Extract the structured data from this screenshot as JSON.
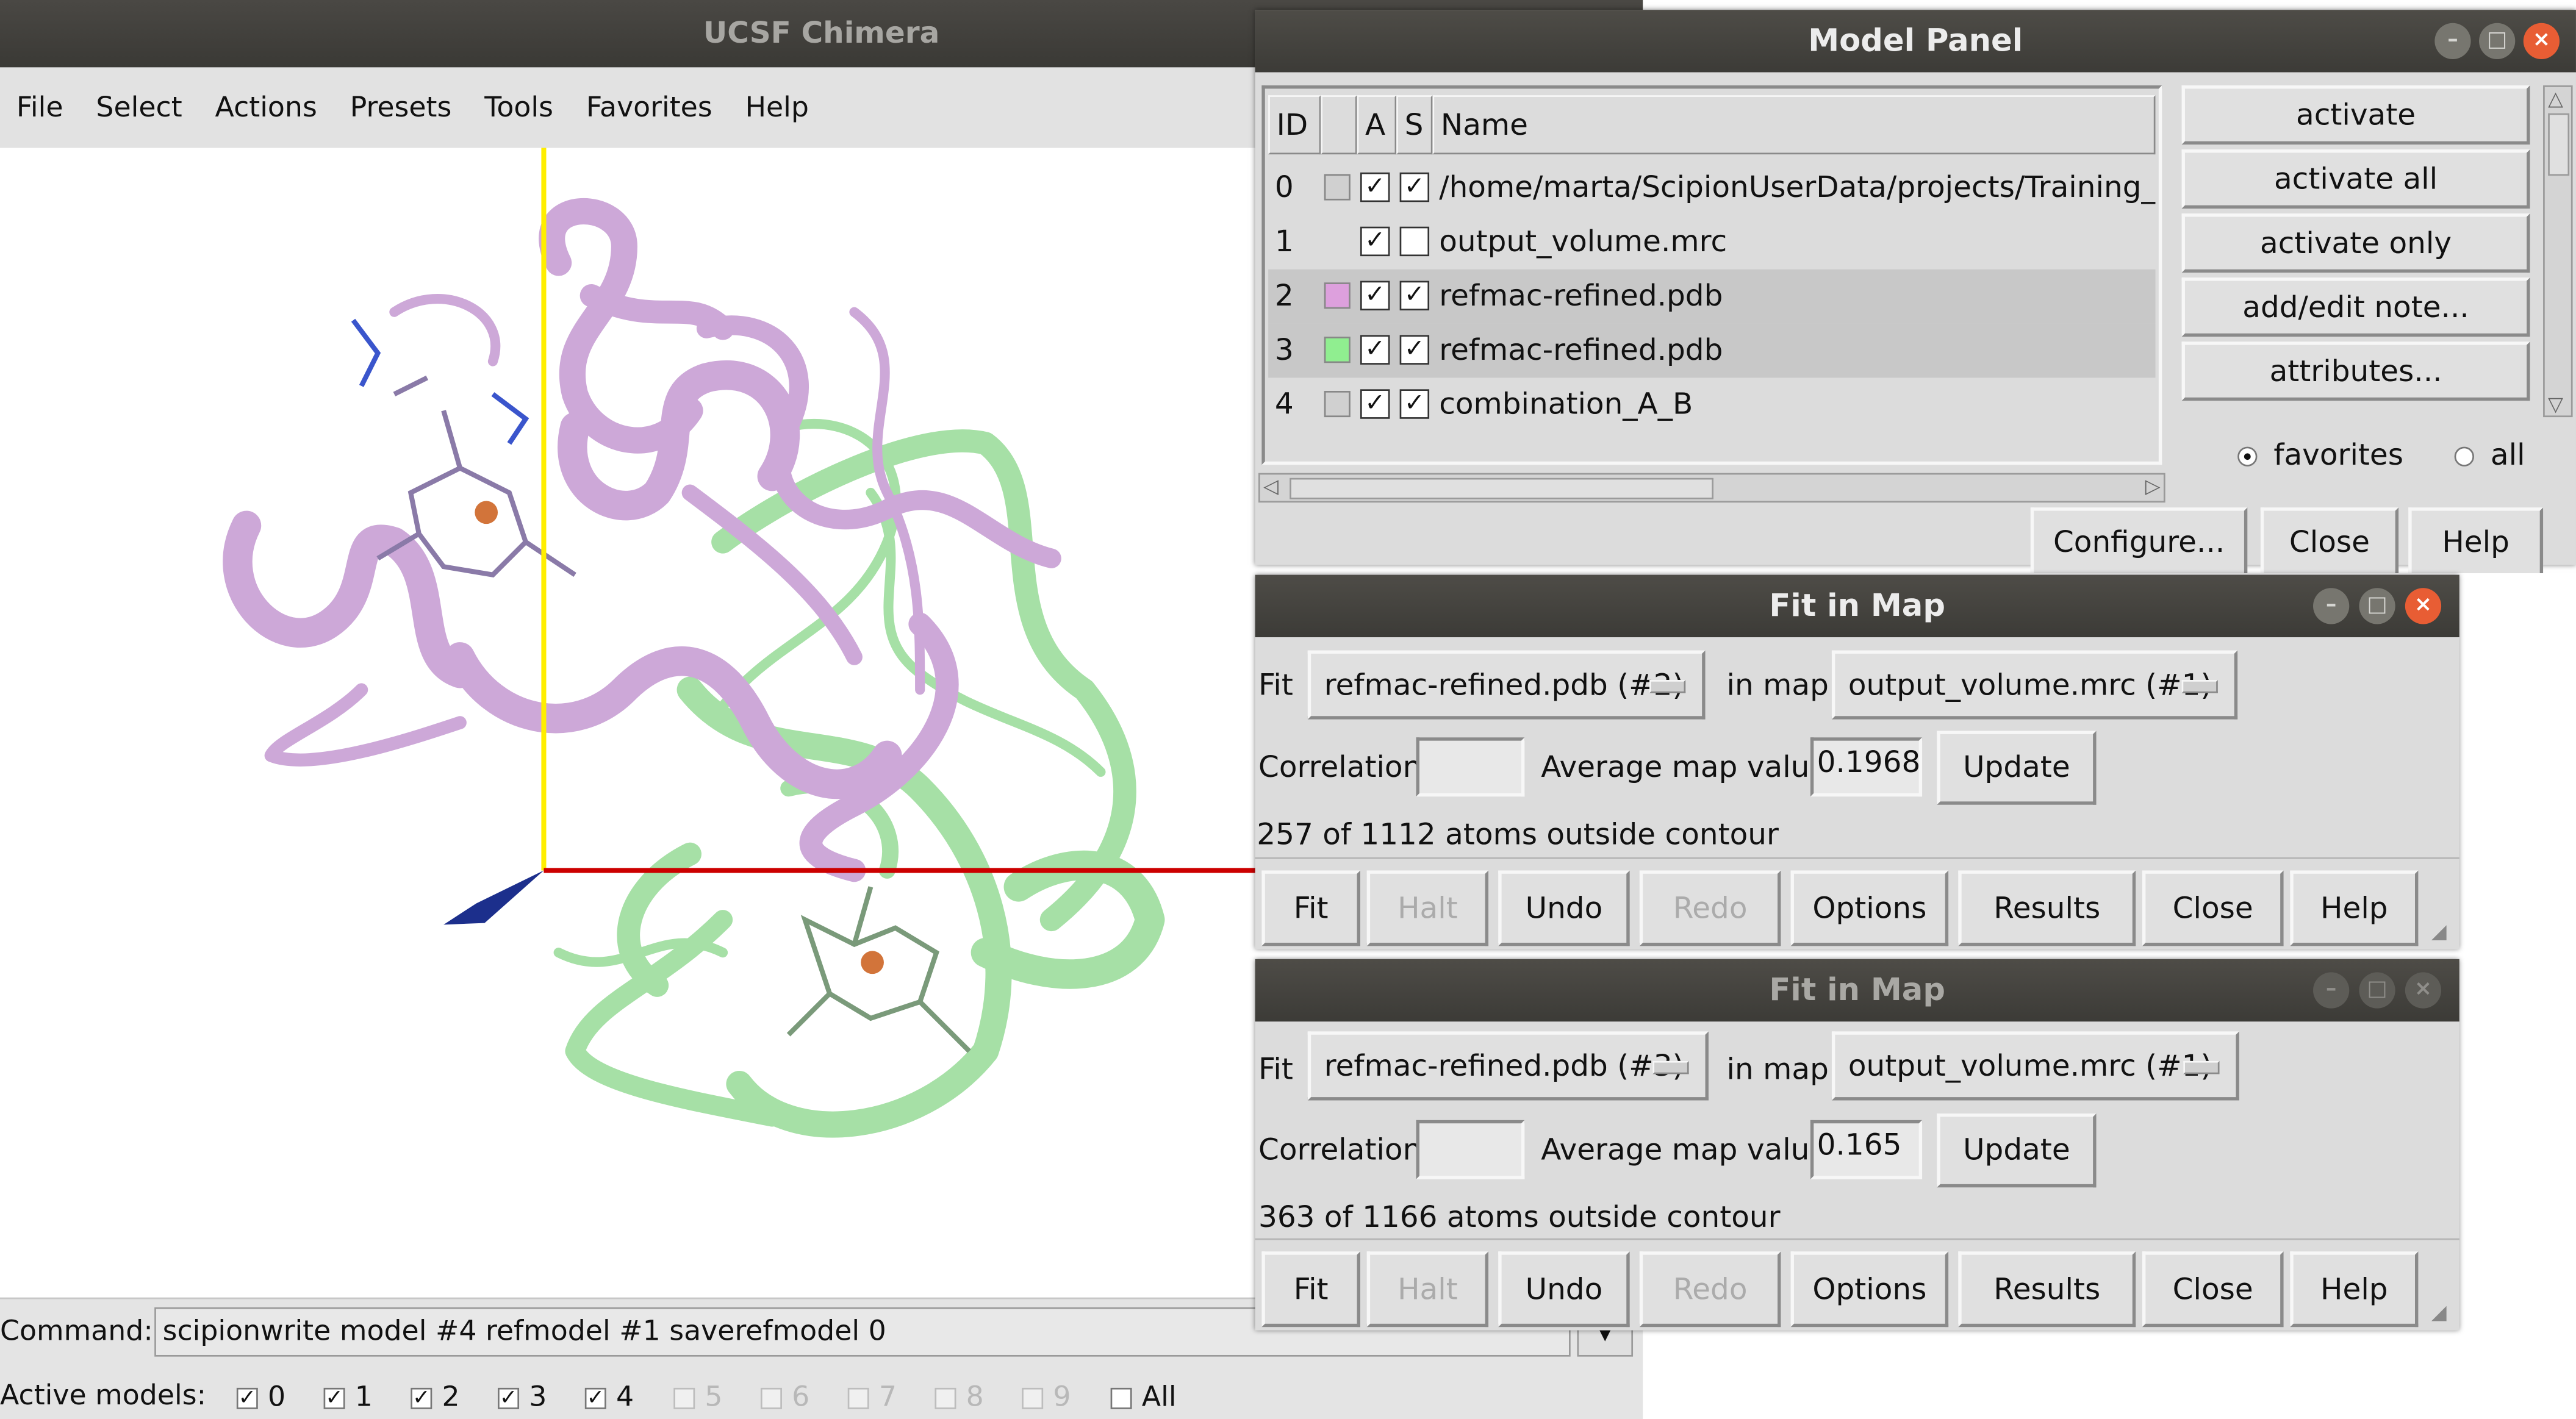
{
  "chimera": {
    "title": "UCSF Chimera",
    "menu": [
      "File",
      "Select",
      "Actions",
      "Presets",
      "Tools",
      "Favorites",
      "Help"
    ],
    "command_label": "Command:",
    "command_value": "scipionwrite model #4 refmodel #1 saverefmodel 0",
    "active_models_label": "Active models:",
    "active_models": [
      {
        "label": "0",
        "checked": true,
        "enabled": true
      },
      {
        "label": "1",
        "checked": true,
        "enabled": true
      },
      {
        "label": "2",
        "checked": true,
        "enabled": true
      },
      {
        "label": "3",
        "checked": true,
        "enabled": true
      },
      {
        "label": "4",
        "checked": true,
        "enabled": true
      },
      {
        "label": "5",
        "checked": false,
        "enabled": false
      },
      {
        "label": "6",
        "checked": false,
        "enabled": false
      },
      {
        "label": "7",
        "checked": false,
        "enabled": false
      },
      {
        "label": "8",
        "checked": false,
        "enabled": false
      },
      {
        "label": "9",
        "checked": false,
        "enabled": false
      },
      {
        "label": "All",
        "checked": false,
        "enabled": true
      }
    ],
    "viewer": {
      "chain_a_color": "#cda8d8",
      "chain_b_color": "#a6e0a6",
      "x_axis_color": "#cc0000",
      "y_axis_color": "#ffee00",
      "z_axis_color": "#1c2f8c"
    }
  },
  "model_panel": {
    "title": "Model Panel",
    "columns": {
      "id": "ID",
      "a": "A",
      "s": "S",
      "name": "Name"
    },
    "rows": [
      {
        "id": "0",
        "swatch": "#d0d0d0",
        "a": true,
        "s": true,
        "name": "/home/marta/ScipionUserData/projects/Training_nover",
        "selected": false
      },
      {
        "id": "1",
        "swatch": "",
        "a": true,
        "s": false,
        "name": "output_volume.mrc",
        "selected": false
      },
      {
        "id": "2",
        "swatch": "#dda0dd",
        "a": true,
        "s": true,
        "name": "refmac-refined.pdb",
        "selected": true
      },
      {
        "id": "3",
        "swatch": "#90ee90",
        "a": true,
        "s": true,
        "name": "refmac-refined.pdb",
        "selected": true
      },
      {
        "id": "4",
        "swatch": "#d0d0d0",
        "a": true,
        "s": true,
        "name": "combination_A_B",
        "selected": false
      }
    ],
    "actions": [
      "activate",
      "activate all",
      "activate only",
      "add/edit note...",
      "attributes..."
    ],
    "filter_favorites": "favorites",
    "filter_all": "all",
    "bottom_buttons": [
      "Configure...",
      "Close",
      "Help"
    ]
  },
  "fit_windows": [
    {
      "title": "Fit in Map",
      "active": true,
      "fit_label": "Fit",
      "fit_value": "refmac-refined.pdb (#2)",
      "in_map_label": "in map",
      "map_value": "output_volume.mrc (#1)",
      "correlation_label": "Correlation",
      "correlation_value": "",
      "avg_label": "Average map value",
      "avg_value": "0.1968",
      "update_label": "Update",
      "status": "257 of 1112 atoms outside contour",
      "buttons": [
        {
          "label": "Fit",
          "enabled": true
        },
        {
          "label": "Halt",
          "enabled": false
        },
        {
          "label": "Undo",
          "enabled": true
        },
        {
          "label": "Redo",
          "enabled": false
        },
        {
          "label": "Options",
          "enabled": true
        },
        {
          "label": "Results",
          "enabled": true
        },
        {
          "label": "Close",
          "enabled": true
        },
        {
          "label": "Help",
          "enabled": true
        }
      ]
    },
    {
      "title": "Fit in Map",
      "active": false,
      "fit_label": "Fit",
      "fit_value": "refmac-refined.pdb (#3)",
      "in_map_label": "in map",
      "map_value": "output_volume.mrc (#1)",
      "correlation_label": "Correlation",
      "correlation_value": "",
      "avg_label": "Average map value",
      "avg_value": "0.165",
      "update_label": "Update",
      "status": "363 of 1166 atoms outside contour",
      "buttons": [
        {
          "label": "Fit",
          "enabled": true
        },
        {
          "label": "Halt",
          "enabled": false
        },
        {
          "label": "Undo",
          "enabled": true
        },
        {
          "label": "Redo",
          "enabled": false
        },
        {
          "label": "Options",
          "enabled": true
        },
        {
          "label": "Results",
          "enabled": true
        },
        {
          "label": "Close",
          "enabled": true
        },
        {
          "label": "Help",
          "enabled": true
        }
      ]
    }
  ]
}
